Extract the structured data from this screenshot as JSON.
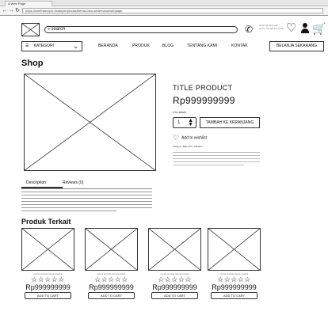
{
  "browser": {
    "tab_title": "A Web Page",
    "url": "https://wireframepro.example/product/tema-toko-sederhana/webpage",
    "back_glyph": "←",
    "forward_glyph": "→",
    "reload_glyph": "↻"
  },
  "header": {
    "search_placeholder": "search",
    "contact_text": "Hubungi kami call center kontak informasi",
    "icons": [
      "logo-placeholder",
      "phone-icon",
      "heart-icon",
      "user-icon",
      "cart-icon"
    ]
  },
  "nav": {
    "kategori_label": "KATEGORI",
    "links": [
      "BERANDA",
      "PRODUK",
      "BLOG",
      "TENTANG KAMI",
      "KONTAK"
    ],
    "cta_label": "BELANJA SEKARANG"
  },
  "page": {
    "title": "Shop"
  },
  "product": {
    "title": "TITLE PRODUCT",
    "price": "Rp999999999",
    "stock": "4 in stock",
    "quantity": "1",
    "add_to_cart_label": "TAMBAH KE KERANJANG",
    "wishlist_label": "Add to wishlist",
    "category": "Kategori: Baju Pria, Pakaian"
  },
  "tabs": {
    "description": "Description",
    "reviews": "Reviews (0)"
  },
  "related": {
    "title": "Produk Terkait",
    "items": [
      {
        "caption": "nama produk nama produk",
        "stars": "☆☆☆☆☆",
        "price": "Rp999999999",
        "button": "ADD TO CART"
      },
      {
        "caption": "nama produk nama produk",
        "stars": "☆☆☆☆☆",
        "price": "Rp999999999",
        "button": "ADD TO CART"
      },
      {
        "caption": "nama produk nama produk",
        "stars": "☆☆☆☆☆",
        "price": "Rp999999999",
        "button": "ADD TO CART"
      },
      {
        "caption": "nama produk nama produk",
        "stars": "☆☆☆☆☆",
        "price": "Rp999999999",
        "button": "ADD TO CART"
      }
    ]
  }
}
